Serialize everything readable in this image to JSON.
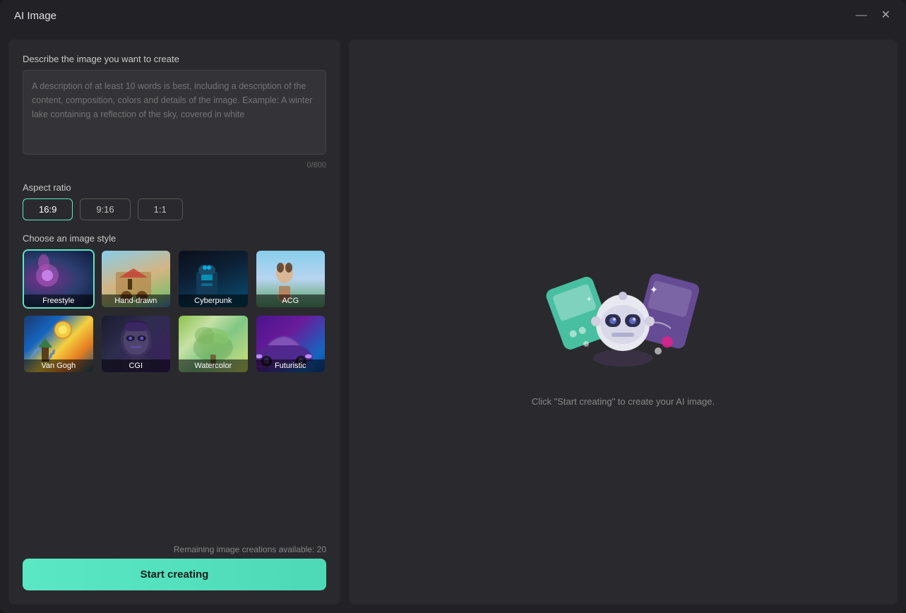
{
  "window": {
    "title": "AI Image",
    "minimize_label": "minimize",
    "close_label": "close"
  },
  "left": {
    "describe_label": "Describe the image you want to create",
    "textarea_placeholder": "A description of at least 10 words is best, including a description of the content, composition, colors and details of the image. Example: A winter lake containing a reflection of the sky, covered in white",
    "char_count": "0/800",
    "aspect_ratio_label": "Aspect ratio",
    "aspect_options": [
      {
        "value": "16:9",
        "active": true
      },
      {
        "value": "9:16",
        "active": false
      },
      {
        "value": "1:1",
        "active": false
      }
    ],
    "style_label": "Choose an image style",
    "styles": [
      {
        "id": "freestyle",
        "label": "Freestyle",
        "selected": true,
        "thumb_class": "thumb-freestyle"
      },
      {
        "id": "hand-drawn",
        "label": "Hand-drawn",
        "selected": false,
        "thumb_class": "thumb-handdrawn"
      },
      {
        "id": "cyberpunk",
        "label": "Cyberpunk",
        "selected": false,
        "thumb_class": "thumb-cyberpunk"
      },
      {
        "id": "acg",
        "label": "ACG",
        "selected": false,
        "thumb_class": "thumb-acg"
      },
      {
        "id": "van-gogh",
        "label": "Van Gogh",
        "selected": false,
        "thumb_class": "thumb-vangogh"
      },
      {
        "id": "cgi",
        "label": "CGI",
        "selected": false,
        "thumb_class": "thumb-cgi"
      },
      {
        "id": "watercolor",
        "label": "Watercolor",
        "selected": false,
        "thumb_class": "thumb-watercolor"
      },
      {
        "id": "futuristic",
        "label": "Futuristic",
        "selected": false,
        "thumb_class": "thumb-futuristic"
      }
    ],
    "remaining_text": "Remaining image creations available: 20",
    "start_btn_label": "Start creating"
  },
  "right": {
    "hint_text": "Click \"Start creating\" to create your AI image."
  }
}
